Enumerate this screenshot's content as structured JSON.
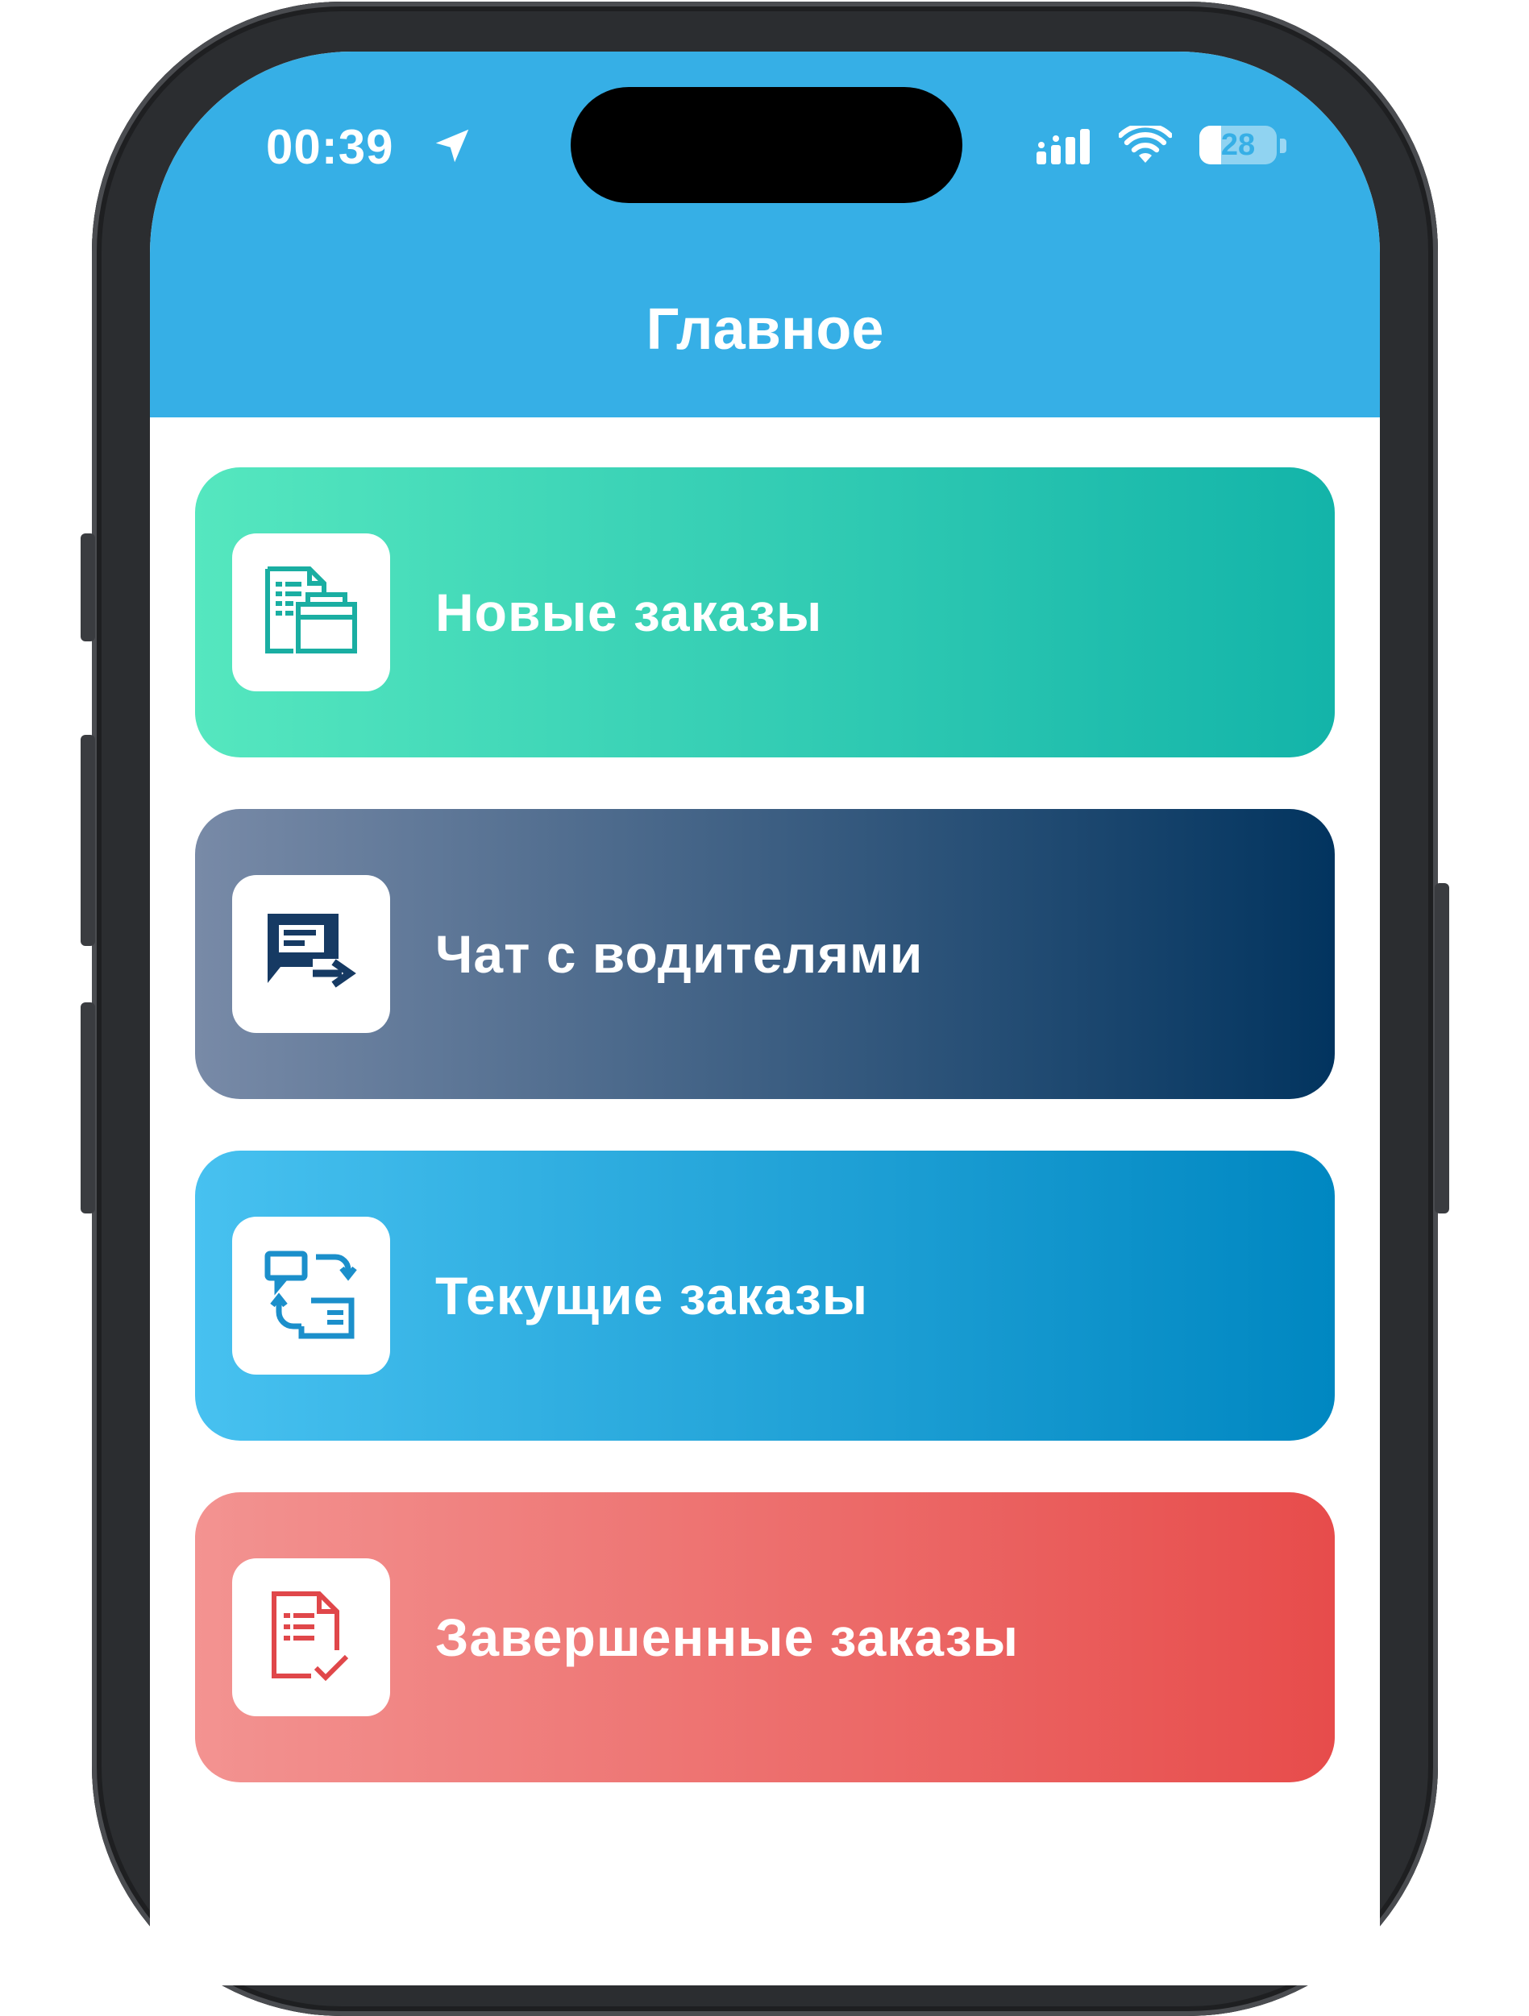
{
  "status_bar": {
    "time": "00:39",
    "battery_level": "28",
    "battery_fraction": 0.28,
    "icons": [
      "location-arrow-icon",
      "cellular-signal-icon",
      "wifi-icon",
      "battery-icon"
    ]
  },
  "header": {
    "title": "Главное",
    "color": "#36afe6"
  },
  "menu": {
    "items": [
      {
        "label": "Новые заказы",
        "icon": "new-orders-icon",
        "gradient": [
          "#55e7bf",
          "#13b4a9"
        ],
        "icon_color": "#1aaea2"
      },
      {
        "label": "Чат с водителями",
        "icon": "chat-icon",
        "gradient": [
          "#788aa7",
          "#02345f"
        ],
        "icon_color": "#163a63"
      },
      {
        "label": "Текущие заказы",
        "icon": "current-orders-icon",
        "gradient": [
          "#47c1f0",
          "#0087c1"
        ],
        "icon_color": "#1b8fcb"
      },
      {
        "label": "Завершенные заказы",
        "icon": "completed-orders-icon",
        "gradient": [
          "#f39391",
          "#e74c4b"
        ],
        "icon_color": "#e0474a"
      }
    ]
  }
}
